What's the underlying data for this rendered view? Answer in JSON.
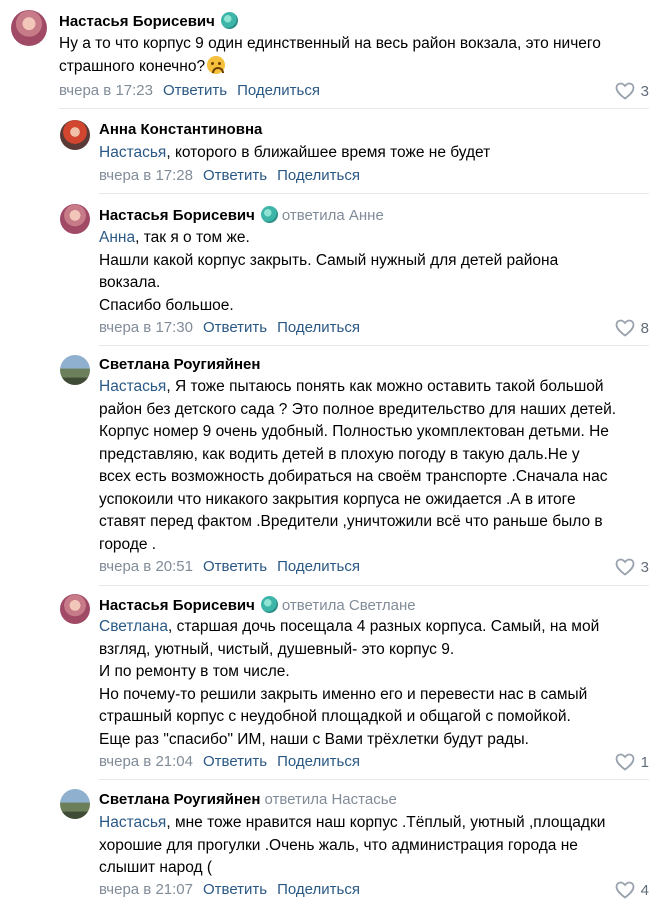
{
  "comments": [
    {
      "author": "Настасья Борисевич",
      "reply_to": "",
      "mention": "",
      "text": "Ну а то что корпус 9 один единственный на весь район вокзала, это ничего\nстрашного конечно?",
      "time": "вчера в 17:23",
      "reply_label": "Ответить",
      "share_label": "Поделиться",
      "likes": "3"
    },
    {
      "author": "Анна Константиновна",
      "reply_to": "",
      "mention": "Настасья",
      "text": ", которого в ближайшее время тоже не будет",
      "time": "вчера в 17:28",
      "reply_label": "Ответить",
      "share_label": "Поделиться",
      "likes": ""
    },
    {
      "author": "Настасья Борисевич",
      "reply_to": "ответила Анне",
      "mention": "Анна",
      "text": ", так я о том же.\nНашли какой корпус закрыть. Самый нужный для детей района\nвокзала.\nСпасибо большое.",
      "time": "вчера в 17:30",
      "reply_label": "Ответить",
      "share_label": "Поделиться",
      "likes": "8"
    },
    {
      "author": "Светлана Роугияйнен",
      "reply_to": "",
      "mention": "Настасья",
      "text": ", Я тоже пытаюсь понять как можно оставить такой большой\nрайон без детского сада ? Это полное вредительство для наших детей.\nКорпус номер 9 очень удобный. Полностью укомплектован детьми. Не\nпредставляю, как водить детей в плохую погоду в такую даль.Не у\nвсех есть возможность добираться на своём транспорте .Сначала нас\nуспокоили что никакого закрытия корпуса не ожидается .А в итоге\nставят перед фактом .Вредители ,уничтожили всё что раньше было в\nгороде .",
      "time": "вчера в 20:51",
      "reply_label": "Ответить",
      "share_label": "Поделиться",
      "likes": "3"
    },
    {
      "author": "Настасья Борисевич",
      "reply_to": "ответила Светлане",
      "mention": "Светлана",
      "text": ", старшая дочь посещала 4 разных корпуса. Самый, на мой\nвзгляд, уютный, чистый, душевный- это корпус 9.\nИ по ремонту в том числе.\nНо почему-то решили закрыть именно его и перевести нас в самый\nстрашный корпус с неудобной площадкой и общагой с помойкой.\nЕще раз \"спасибо\" ИМ, наши с Вами трёхлетки будут рады.",
      "time": "вчера в 21:04",
      "reply_label": "Ответить",
      "share_label": "Поделиться",
      "likes": "1"
    },
    {
      "author": "Светлана Роугияйнен",
      "reply_to": "ответила Настасье",
      "mention": "Настасья",
      "text": ", мне тоже нравится наш корпус .Тёплый, уютный ,площадки\nхорошие для прогулки .Очень жаль, что администрация города не\nслышит народ (",
      "time": "вчера в 21:07",
      "reply_label": "Ответить",
      "share_label": "Поделиться",
      "likes": "4"
    }
  ],
  "colors": {
    "link": "#2a5885",
    "secondary": "#818c99",
    "divider": "#e7e8ec"
  }
}
